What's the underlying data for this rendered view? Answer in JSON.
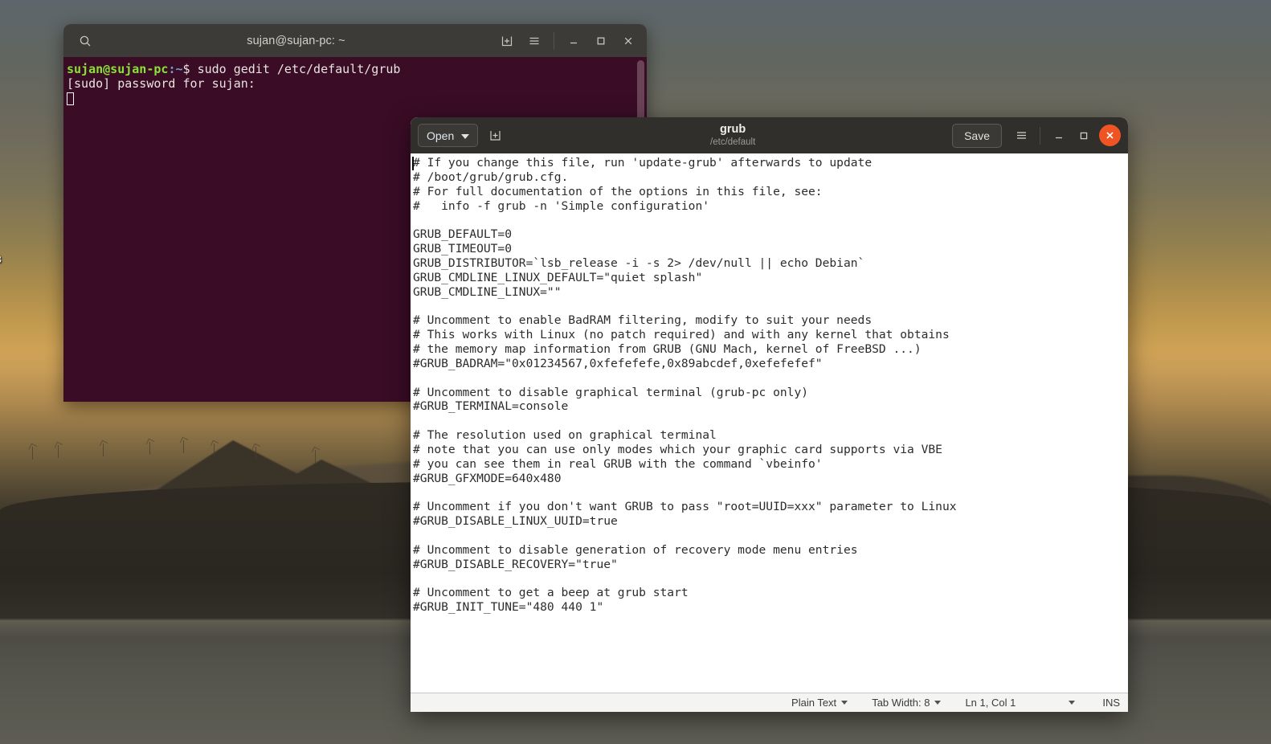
{
  "desktop": {
    "icon_label_partial": "B"
  },
  "terminal": {
    "title": "sujan@sujan-pc: ~",
    "search_icon": "search-icon",
    "new_tab_icon": "new-tab-icon",
    "menu_icon": "hamburger-menu-icon",
    "minimize_icon": "minimize-icon",
    "maximize_icon": "maximize-icon",
    "close_icon": "close-icon",
    "bg_color": "#3a0c26",
    "prompt_color": "#8ae234",
    "lines": {
      "prompt_user": "sujan@sujan-pc",
      "prompt_path": ":~",
      "prompt_symbol": "$ ",
      "command": "sudo gedit /etc/default/grub",
      "password_prompt": "[sudo] password for sujan:"
    }
  },
  "gedit": {
    "open_label": "Open",
    "open_caret_icon": "chevron-down-icon",
    "new_document_icon": "new-document-icon",
    "title": "grub",
    "subtitle": "/etc/default",
    "save_label": "Save",
    "menu_icon": "hamburger-menu-icon",
    "minimize_icon": "minimize-icon",
    "maximize_icon": "maximize-icon",
    "close_icon": "close-icon",
    "close_color": "#f05423",
    "document_text": "# If you change this file, run 'update-grub' afterwards to update\n# /boot/grub/grub.cfg.\n# For full documentation of the options in this file, see:\n#   info -f grub -n 'Simple configuration'\n\nGRUB_DEFAULT=0\nGRUB_TIMEOUT=0\nGRUB_DISTRIBUTOR=`lsb_release -i -s 2> /dev/null || echo Debian`\nGRUB_CMDLINE_LINUX_DEFAULT=\"quiet splash\"\nGRUB_CMDLINE_LINUX=\"\"\n\n# Uncomment to enable BadRAM filtering, modify to suit your needs\n# This works with Linux (no patch required) and with any kernel that obtains\n# the memory map information from GRUB (GNU Mach, kernel of FreeBSD ...)\n#GRUB_BADRAM=\"0x01234567,0xfefefefe,0x89abcdef,0xefefefef\"\n\n# Uncomment to disable graphical terminal (grub-pc only)\n#GRUB_TERMINAL=console\n\n# The resolution used on graphical terminal\n# note that you can use only modes which your graphic card supports via VBE\n# you can see them in real GRUB with the command `vbeinfo'\n#GRUB_GFXMODE=640x480\n\n# Uncomment if you don't want GRUB to pass \"root=UUID=xxx\" parameter to Linux\n#GRUB_DISABLE_LINUX_UUID=true\n\n# Uncomment to disable generation of recovery mode menu entries\n#GRUB_DISABLE_RECOVERY=\"true\"\n\n# Uncomment to get a beep at grub start\n#GRUB_INIT_TUNE=\"480 440 1\"",
    "statusbar": {
      "language": "Plain Text",
      "tab_width": "Tab Width: 8",
      "position": "Ln 1, Col 1",
      "insert_mode": "INS"
    }
  }
}
